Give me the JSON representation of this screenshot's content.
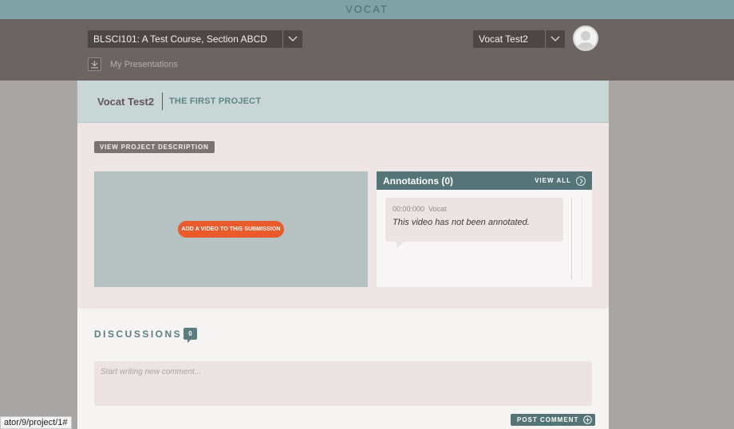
{
  "app": {
    "brand": "VOCAT"
  },
  "header": {
    "course_select": "BLSCI101: A Test Course, Section ABCD",
    "user_select": "Vocat Test2",
    "my_presentations": "My Presentations"
  },
  "project": {
    "user_name": "Vocat Test2",
    "project_name": "THE FIRST PROJECT",
    "view_description_label": "VIEW PROJECT DESCRIPTION"
  },
  "video": {
    "add_video_label": "ADD A VIDEO TO THIS SUBMISSION"
  },
  "annotations": {
    "title": "Annotations (0)",
    "view_all_label": "VIEW ALL",
    "items": [
      {
        "time": "00:00:000",
        "author": "Vocat",
        "text": "This video has not been annotated."
      }
    ]
  },
  "discussions": {
    "title": "DISCUSSIONS",
    "count": "0",
    "comment_placeholder": "Start writing new comment...",
    "post_label": "POST COMMENT"
  },
  "status_bar": {
    "url": "ator/9/project/1#"
  },
  "colors": {
    "topbar": "#7fa3a4",
    "header": "#6b6462",
    "accent": "#557477",
    "orange": "#ea5a2a"
  },
  "icons": [
    "chevron-down-icon",
    "download-icon",
    "user-avatar-icon",
    "arrow-right-circle-icon",
    "plus-circle-icon",
    "comment-badge-icon"
  ]
}
